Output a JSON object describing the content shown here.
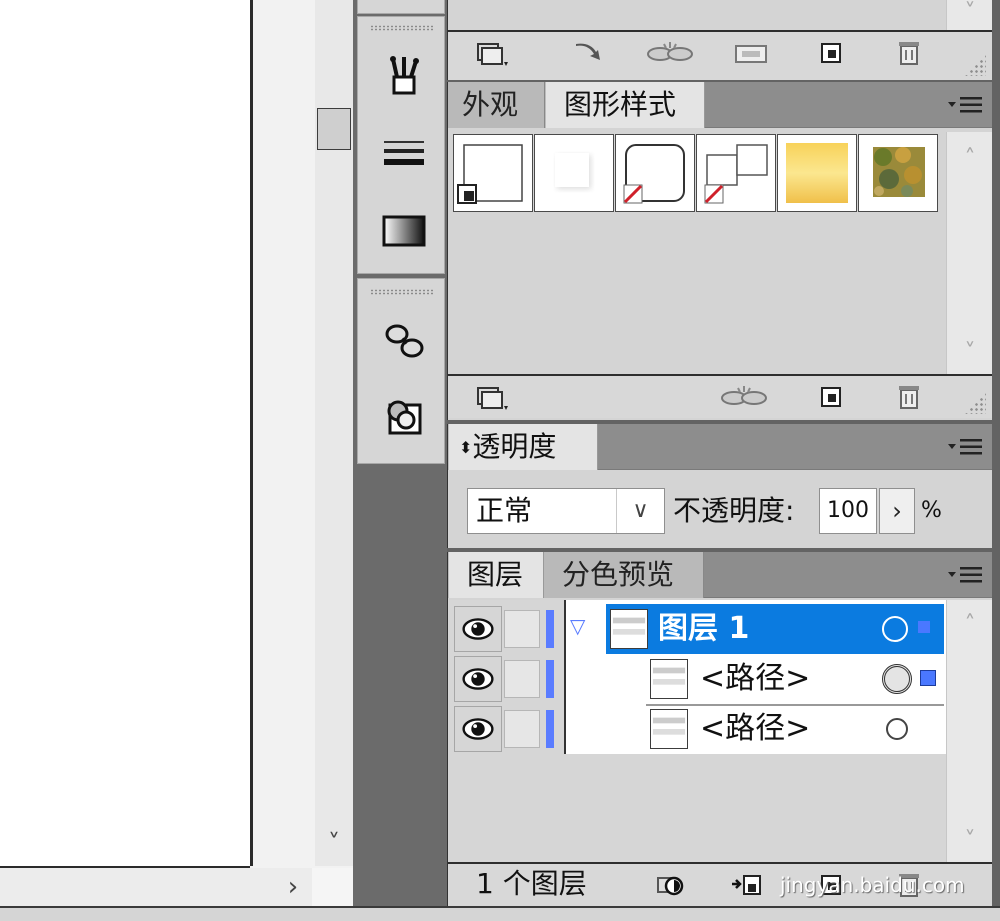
{
  "appearance_panel": {
    "tab_label": "外观"
  },
  "graphic_styles_panel": {
    "tab_label": "图形样式"
  },
  "transparency_panel": {
    "tab_label": "透明度",
    "blend_mode": "正常",
    "opacity_label": "不透明度:",
    "opacity_value": "100",
    "percent": "%"
  },
  "layers_panel": {
    "tabs": [
      {
        "label": "图层"
      },
      {
        "label": "分色预览"
      }
    ],
    "rows": [
      {
        "name": "图层 1"
      },
      {
        "name": "<路径>"
      },
      {
        "name": "<路径>"
      }
    ],
    "status": "1 个图层"
  },
  "colors": {
    "selection": "#0b7be0",
    "layer_color": "#5a7cff"
  },
  "watermark": "jingyan.baidu.com"
}
